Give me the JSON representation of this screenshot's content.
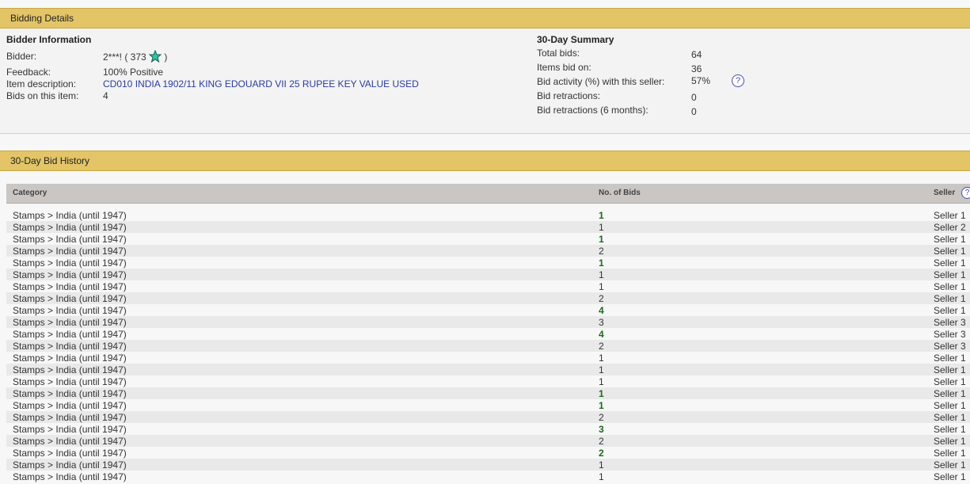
{
  "header": {
    "title": "Bidding Details"
  },
  "bidder_info": {
    "title": "Bidder Information",
    "bidder_label": "Bidder:",
    "bidder_value": "2***! ( 373",
    "bidder_close": ")",
    "feedback_label": "Feedback:",
    "feedback_value": "100% Positive",
    "item_label": "Item description:",
    "item_value": "CD010 INDIA 1902/11 KING EDOUARD VII 25 RUPEE KEY VALUE USED",
    "bids_label": "Bids on this item:",
    "bids_value": "4"
  },
  "summary": {
    "title": "30-Day Summary",
    "rows": [
      {
        "label": "Total bids:",
        "value": "64"
      },
      {
        "label": "Items bid on:",
        "value": "36"
      },
      {
        "label": "Bid activity (%) with this seller:",
        "value": "57%"
      },
      {
        "label": "Bid retractions:",
        "value": "0"
      },
      {
        "label": "Bid retractions (6 months):",
        "value": "0"
      }
    ],
    "help_glyph": "?"
  },
  "history": {
    "title": "30-Day Bid History",
    "columns": {
      "category": "Category",
      "bids": "No. of Bids",
      "seller": "Seller"
    },
    "help_glyph": "?",
    "rows": [
      {
        "category": "Stamps > India (until 1947)",
        "bids": "1",
        "highlight": true,
        "seller": "Seller 1"
      },
      {
        "category": "Stamps > India (until 1947)",
        "bids": "1",
        "highlight": false,
        "seller": "Seller 2"
      },
      {
        "category": "Stamps > India (until 1947)",
        "bids": "1",
        "highlight": true,
        "seller": "Seller 1"
      },
      {
        "category": "Stamps > India (until 1947)",
        "bids": "2",
        "highlight": false,
        "seller": "Seller 1"
      },
      {
        "category": "Stamps > India (until 1947)",
        "bids": "1",
        "highlight": true,
        "seller": "Seller 1"
      },
      {
        "category": "Stamps > India (until 1947)",
        "bids": "1",
        "highlight": false,
        "seller": "Seller 1"
      },
      {
        "category": "Stamps > India (until 1947)",
        "bids": "1",
        "highlight": false,
        "seller": "Seller 1"
      },
      {
        "category": "Stamps > India (until 1947)",
        "bids": "2",
        "highlight": false,
        "seller": "Seller 1"
      },
      {
        "category": "Stamps > India (until 1947)",
        "bids": "4",
        "highlight": true,
        "seller": "Seller 1"
      },
      {
        "category": "Stamps > India (until 1947)",
        "bids": "3",
        "highlight": false,
        "seller": "Seller 3"
      },
      {
        "category": "Stamps > India (until 1947)",
        "bids": "4",
        "highlight": true,
        "seller": "Seller 3"
      },
      {
        "category": "Stamps > India (until 1947)",
        "bids": "2",
        "highlight": false,
        "seller": "Seller 3"
      },
      {
        "category": "Stamps > India (until 1947)",
        "bids": "1",
        "highlight": false,
        "seller": "Seller 1"
      },
      {
        "category": "Stamps > India (until 1947)",
        "bids": "1",
        "highlight": false,
        "seller": "Seller 1"
      },
      {
        "category": "Stamps > India (until 1947)",
        "bids": "1",
        "highlight": false,
        "seller": "Seller 1"
      },
      {
        "category": "Stamps > India (until 1947)",
        "bids": "1",
        "highlight": true,
        "seller": "Seller 1"
      },
      {
        "category": "Stamps > India (until 1947)",
        "bids": "1",
        "highlight": true,
        "seller": "Seller 1"
      },
      {
        "category": "Stamps > India (until 1947)",
        "bids": "2",
        "highlight": false,
        "seller": "Seller 1"
      },
      {
        "category": "Stamps > India (until 1947)",
        "bids": "3",
        "highlight": true,
        "seller": "Seller 1"
      },
      {
        "category": "Stamps > India (until 1947)",
        "bids": "2",
        "highlight": false,
        "seller": "Seller 1"
      },
      {
        "category": "Stamps > India (until 1947)",
        "bids": "2",
        "highlight": true,
        "seller": "Seller 1"
      },
      {
        "category": "Stamps > India (until 1947)",
        "bids": "1",
        "highlight": false,
        "seller": "Seller 1"
      },
      {
        "category": "Stamps > India (until 1947)",
        "bids": "1",
        "highlight": false,
        "seller": "Seller 1"
      }
    ]
  }
}
